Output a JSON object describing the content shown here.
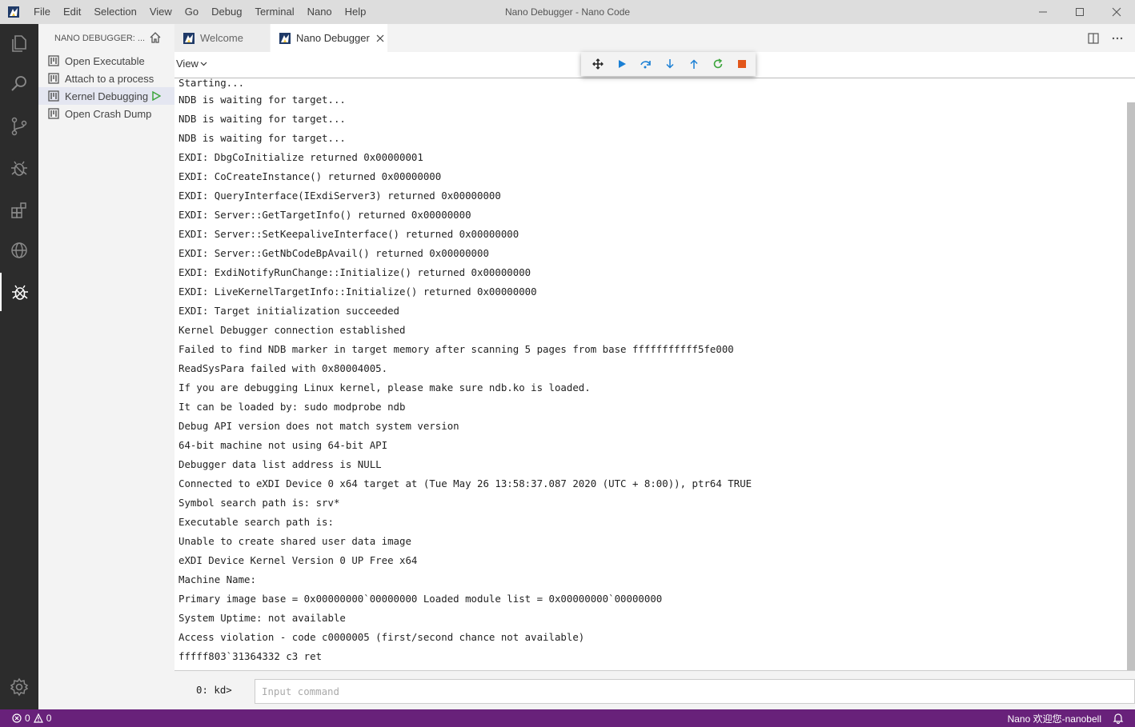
{
  "window": {
    "title": "Nano Debugger - Nano Code",
    "menu": [
      "File",
      "Edit",
      "Selection",
      "View",
      "Go",
      "Debug",
      "Terminal",
      "Nano",
      "Help"
    ]
  },
  "activitybar": {
    "icons": [
      "explorer-icon",
      "search-icon",
      "source-control-icon",
      "debug-icon",
      "extensions-icon",
      "remote-icon",
      "nano-debugger-icon",
      "settings-gear-icon"
    ]
  },
  "sidebar": {
    "title": "NANO DEBUGGER: ...",
    "items": [
      {
        "label": "Open Executable"
      },
      {
        "label": "Attach to a process"
      },
      {
        "label": "Kernel Debugging"
      },
      {
        "label": "Open Crash Dump"
      }
    ]
  },
  "tabs": [
    {
      "label": "Welcome"
    },
    {
      "label": "Nano Debugger"
    }
  ],
  "view_menu": {
    "label": "View"
  },
  "output": {
    "lines": [
      "Starting...",
      "NDB is waiting for target...",
      "NDB is waiting for target...",
      "NDB is waiting for target...",
      "EXDI: DbgCoInitialize returned 0x00000001",
      "EXDI: CoCreateInstance() returned 0x00000000",
      "EXDI: QueryInterface(IExdiServer3) returned 0x00000000",
      "EXDI: Server::GetTargetInfo() returned 0x00000000",
      "EXDI: Server::SetKeepaliveInterface() returned 0x00000000",
      "EXDI: Server::GetNbCodeBpAvail() returned 0x00000000",
      "EXDI: ExdiNotifyRunChange::Initialize() returned 0x00000000",
      "EXDI: LiveKernelTargetInfo::Initialize() returned 0x00000000",
      "EXDI: Target initialization succeeded",
      "Kernel Debugger connection established",
      "Failed to find NDB marker in target memory after scanning 5 pages from base fffffffffff5fe000",
      "ReadSysPara failed with 0x80004005.",
      "If you are debugging Linux kernel, please make sure ndb.ko is loaded.",
      "It can be loaded by: sudo modprobe ndb",
      "Debug API version does not match system version",
      "64-bit machine not using 64-bit API",
      "Debugger data list address is NULL",
      "Connected to eXDI Device 0 x64 target at (Tue May 26 13:58:37.087 2020 (UTC + 8:00)), ptr64 TRUE",
      "Symbol search path is: srv*",
      "Executable search path is:",
      "Unable to create shared user data image",
      "eXDI Device Kernel Version 0 UP Free x64",
      "Machine Name:",
      "Primary image base = 0x00000000`00000000 Loaded module list = 0x00000000`00000000",
      "System Uptime: not available",
      "Access violation - code c0000005 (first/second chance not available)",
      "fffff803`31364332 c3 ret"
    ]
  },
  "command": {
    "prompt": "0: kd>",
    "placeholder": "Input command",
    "value": ""
  },
  "statusbar": {
    "errors": "0",
    "warnings": "0",
    "right_text": "Nano 欢迎您-nanobell"
  },
  "colors": {
    "titlebar": "#dddddd",
    "activitybar": "#2c2c2c",
    "sidebar": "#f3f3f3",
    "statusbar": "#68217a",
    "continue": "#1a7fd4",
    "restart": "#3ca53c",
    "stop": "#e2561a"
  }
}
